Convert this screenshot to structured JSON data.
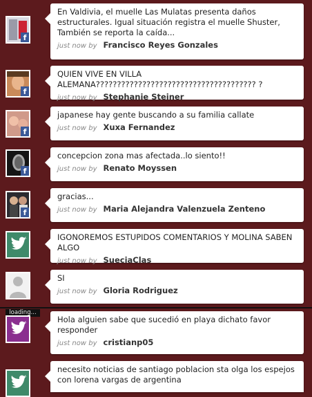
{
  "feed": {
    "loading_label": "loading...",
    "items": [
      {
        "text": "En Valdivia, el muelle Las Mulatas presenta daños estructurales. Igual situación registra el muelle Shuster, También se reporta la caída...",
        "time": "just now by",
        "author": "Francisco Reyes Gonzales",
        "avatar": "photo-fb"
      },
      {
        "text": "QUIEN VIVE EN VILLA ALEMANA?????????????????????????????????????? ?",
        "time": "just now by",
        "author": "Stephanie Steiner",
        "avatar": "photo-fb"
      },
      {
        "text": "japanese hay gente buscando a su familia callate",
        "time": "just now by",
        "author": "Xuxa Fernandez",
        "avatar": "photo-fb"
      },
      {
        "text": "concepcion zona mas afectada..lo siento!!",
        "time": "just now by",
        "author": "Renato Moyssen",
        "avatar": "photo-fb"
      },
      {
        "text": "gracias...",
        "time": "just now by",
        "author": "Maria Alejandra Valenzuela Zenteno",
        "avatar": "photo-fb"
      },
      {
        "text": "IGONOREMOS ESTUPIDOS COMENTARIOS Y MOLINA SABEN ALGO",
        "time": "just now by",
        "author": "SueciaClas",
        "avatar": "twitter-green"
      },
      {
        "text": "SI",
        "time": "just now by",
        "author": "Gloria Rodriguez",
        "avatar": "default-person"
      },
      {
        "text": "Hola alguien sabe que sucedió en playa dichato favor responder",
        "time": "just now by",
        "author": "cristianp05",
        "avatar": "twitter-purple"
      },
      {
        "text": "necesito noticias de santiago poblacion sta olga los espejos con lorena vargas de argentina",
        "time": "",
        "author": "",
        "avatar": "twitter-green"
      }
    ]
  },
  "colors": {
    "background": "#5c1a1d",
    "twitter_green": "#3f8a6a",
    "twitter_purple": "#8a2f8f",
    "facebook": "#3b5998"
  }
}
